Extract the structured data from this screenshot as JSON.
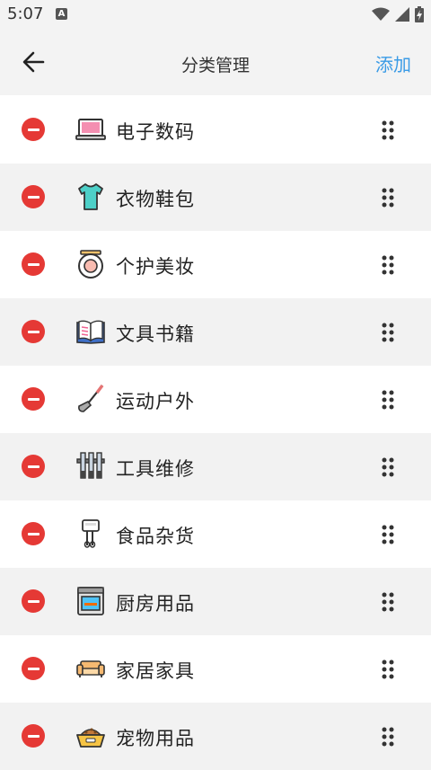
{
  "status_bar": {
    "time": "5:07",
    "notification_letter": "A"
  },
  "header": {
    "title": "分类管理",
    "add_label": "添加"
  },
  "categories": [
    {
      "label": "电子数码",
      "icon": "laptop-icon"
    },
    {
      "label": "衣物鞋包",
      "icon": "tshirt-icon"
    },
    {
      "label": "个护美妆",
      "icon": "compact-mirror-icon"
    },
    {
      "label": "文具书籍",
      "icon": "open-book-icon"
    },
    {
      "label": "运动户外",
      "icon": "golf-club-icon"
    },
    {
      "label": "工具维修",
      "icon": "tool-rack-icon"
    },
    {
      "label": "食品杂货",
      "icon": "hand-mixer-icon"
    },
    {
      "label": "厨房用品",
      "icon": "oven-icon"
    },
    {
      "label": "家居家具",
      "icon": "sofa-icon"
    },
    {
      "label": "宠物用品",
      "icon": "pet-bowl-icon"
    }
  ],
  "colors": {
    "accent": "#3a9be6",
    "delete": "#e53935",
    "row_alt": "#f2f2f2",
    "bar": "#f3f3f3"
  }
}
